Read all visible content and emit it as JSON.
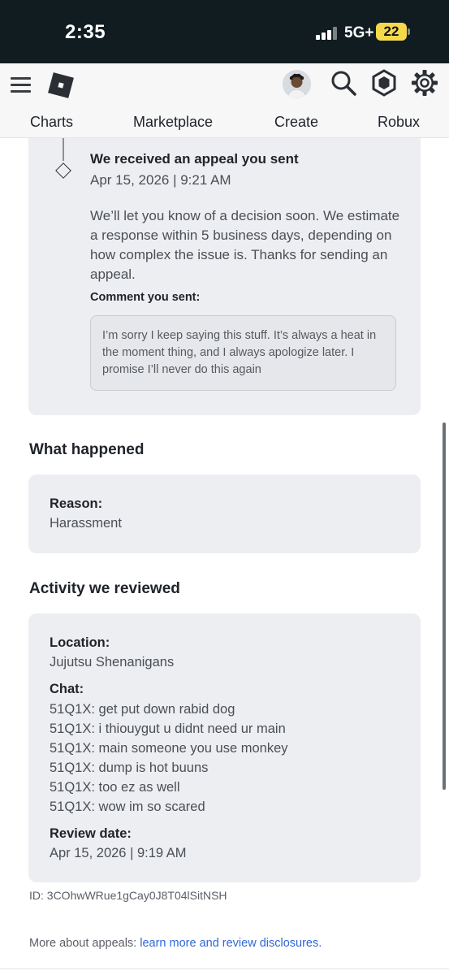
{
  "status_bar": {
    "time": "2:35",
    "network": "5G+",
    "battery": "22"
  },
  "header": {
    "menu_icon": "hamburger-menu-icon",
    "logo_icon": "roblox-logo-icon",
    "avatar_icon": "user-avatar",
    "search_icon": "search-icon",
    "robux_icon": "robux-icon",
    "settings_icon": "gear-icon"
  },
  "nav": {
    "items": [
      {
        "label": "Charts"
      },
      {
        "label": "Marketplace"
      },
      {
        "label": "Create"
      },
      {
        "label": "Robux"
      }
    ]
  },
  "appeal": {
    "title": "We received an appeal you sent",
    "date": "Apr 15, 2026 | 9:21 AM",
    "body": "We’ll let you know of a decision soon. We estimate a response within 5 business days, depending on how complex the issue is. Thanks for sending an appeal.",
    "comment_label": "Comment you sent:",
    "comment": "I’m sorry I keep saying this stuff. It’s always a heat in the moment thing, and I always apologize later. I promise I’ll never do this again"
  },
  "what_happened": {
    "title": "What happened",
    "reason_label": "Reason:",
    "reason_value": "Harassment"
  },
  "activity": {
    "title": "Activity we reviewed",
    "location_label": "Location:",
    "location_value": "Jujutsu Shenanigans",
    "chat_label": "Chat:",
    "chat_lines": [
      "51Q1X: get put down rabid dog",
      "51Q1X: i thiouygut u didnt need ur main",
      "51Q1X: main someone you use monkey",
      "51Q1X: dump is hot buuns",
      "51Q1X: too ez as well",
      "51Q1X: wow im so scared"
    ],
    "review_date_label": "Review date:",
    "review_date_value": "Apr 15, 2026 | 9:19 AM"
  },
  "footer": {
    "id_text": "ID: 3COhwWRue1gCay0J8T04lSitNSH",
    "more_prefix": "More about appeals: ",
    "more_link": "learn more and review disclosures."
  },
  "colors": {
    "status_bar_bg": "#101c20",
    "card_bg": "#edeef1",
    "link": "#2f67d8",
    "battery": "#f5d94c"
  }
}
